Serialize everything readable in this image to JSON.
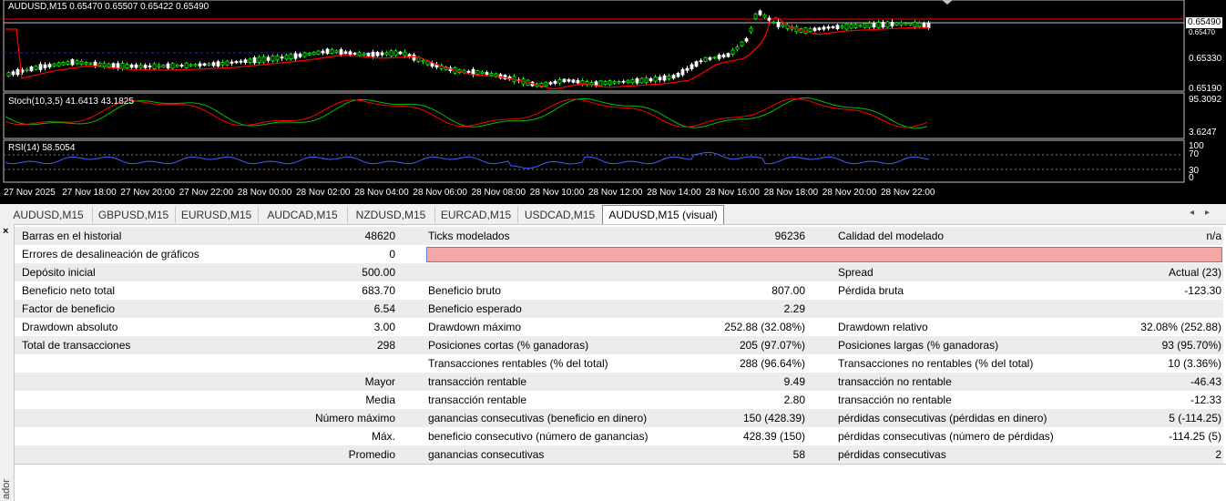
{
  "chart": {
    "header": "AUDUSD,M15  0.65470 0.65507 0.65422 0.65490",
    "current_price": "0.65490",
    "price_tick_partial": "0.65470",
    "price_axis": [
      "0.65330",
      "0.65190"
    ],
    "stoch_label": "Stoch(10,3,5) 41.6413 43.1825",
    "stoch_axis": [
      "95.3092",
      "3.6247"
    ],
    "rsi_label": "RSI(14) 58.5054",
    "rsi_axis": [
      "100",
      "70",
      "30",
      "0"
    ],
    "time_axis": [
      "27 Nov 2025",
      "27 Nov 18:00",
      "27 Nov 20:00",
      "27 Nov 22:00",
      "28 Nov 00:00",
      "28 Nov 02:00",
      "28 Nov 04:00",
      "28 Nov 06:00",
      "28 Nov 08:00",
      "28 Nov 10:00",
      "28 Nov 12:00",
      "28 Nov 14:00",
      "28 Nov 16:00",
      "28 Nov 18:00",
      "28 Nov 20:00",
      "28 Nov 22:00"
    ],
    "colors": {
      "bull": "#00ff00",
      "bear": "#ffffff",
      "ma": "#ff0000",
      "stoch_main": "#00c000",
      "stoch_signal": "#ff0000",
      "rsi": "#4060ff",
      "level": "#ff0000"
    }
  },
  "tabs": [
    "AUDUSD,M15",
    "GBPUSD,M15",
    "EURUSD,M15",
    "AUDCAD,M15",
    "NZDUSD,M15",
    "EURCAD,M15",
    "USDCAD,M15",
    "AUDUSD,M15 (visual)"
  ],
  "active_tab": 7,
  "side_panel": {
    "close": "×",
    "label": "ador"
  },
  "report": {
    "rows": [
      {
        "c1l": "Barras en el historial",
        "c1v": "48620",
        "c2l": "Ticks modelados",
        "c2v": "96236",
        "c3l": "Calidad del modelado",
        "c3v": "n/a"
      },
      {
        "c1l": "Errores de desalineación de gráficos",
        "c1v": "0",
        "c2l": "",
        "c2v": "",
        "c3l": "",
        "c3v": ""
      },
      {
        "c1l": "Depósito inicial",
        "c1v": "500.00",
        "c2l": "",
        "c2v": "",
        "c3l": "Spread",
        "c3v": "Actual (23)"
      },
      {
        "c1l": "Beneficio neto total",
        "c1v": "683.70",
        "c2l": "Beneficio bruto",
        "c2v": "807.00",
        "c3l": "Pérdida bruta",
        "c3v": "-123.30"
      },
      {
        "c1l": "Factor de beneficio",
        "c1v": "6.54",
        "c2l": "Beneficio esperado",
        "c2v": "2.29",
        "c3l": "",
        "c3v": ""
      },
      {
        "c1l": "Drawdown absoluto",
        "c1v": "3.00",
        "c2l": "Drawdown máximo",
        "c2v": "252.88 (32.08%)",
        "c3l": "Drawdown relativo",
        "c3v": "32.08% (252.88)"
      },
      {
        "c1l": "Total de transacciones",
        "c1v": "298",
        "c2l": "Posiciones cortas (% ganadoras)",
        "c2v": "205 (97.07%)",
        "c3l": "Posiciones largas (% ganadoras)",
        "c3v": "93 (95.70%)"
      },
      {
        "c1l": "",
        "c1v": "",
        "c2l": "Transacciones rentables (% del total)",
        "c2v": "288 (96.64%)",
        "c3l": "Transacciones no rentables (% del total)",
        "c3v": "10 (3.36%)"
      },
      {
        "c1l": "",
        "c1v": "Mayor",
        "c2l": "transacción rentable",
        "c2v": "9.49",
        "c3l": "transacción no rentable",
        "c3v": "-46.43"
      },
      {
        "c1l": "",
        "c1v": "Media",
        "c2l": "transacción rentable",
        "c2v": "2.80",
        "c3l": "transacción no rentable",
        "c3v": "-12.33"
      },
      {
        "c1l": "",
        "c1v": "Número máximo",
        "c2l": "ganancias consecutivas (beneficio en dinero)",
        "c2v": "150 (428.39)",
        "c3l": "pérdidas consecutivas (pérdidas en dinero)",
        "c3v": "5 (-114.25)"
      },
      {
        "c1l": "",
        "c1v": "Máx.",
        "c2l": "beneficio consecutivo (número de ganancias)",
        "c2v": "428.39 (150)",
        "c3l": "pérdidas consecutivas (número de pérdidas)",
        "c3v": "-114.25 (5)"
      },
      {
        "c1l": "",
        "c1v": "Promedio",
        "c2l": "ganancias consecutivas",
        "c2v": "58",
        "c3l": "pérdidas consecutivas",
        "c3v": "2"
      }
    ]
  }
}
